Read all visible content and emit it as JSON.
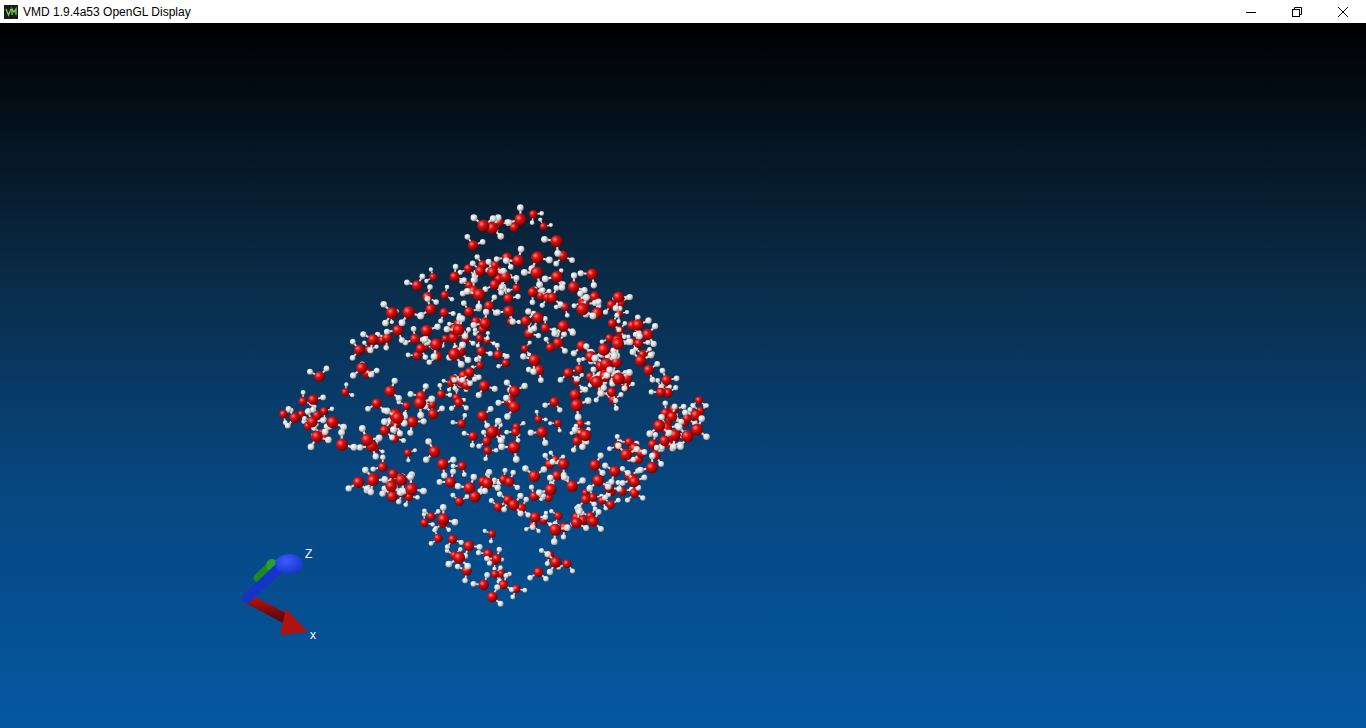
{
  "window": {
    "title": "VMD 1.9.4a53 OpenGL Display"
  },
  "display": {
    "molecule": "water",
    "representation": "CPK",
    "molecule_count": 330,
    "axes": [
      {
        "label": "Z",
        "color": "#1434c8"
      },
      {
        "label": "x",
        "color": "#b01212"
      }
    ]
  }
}
